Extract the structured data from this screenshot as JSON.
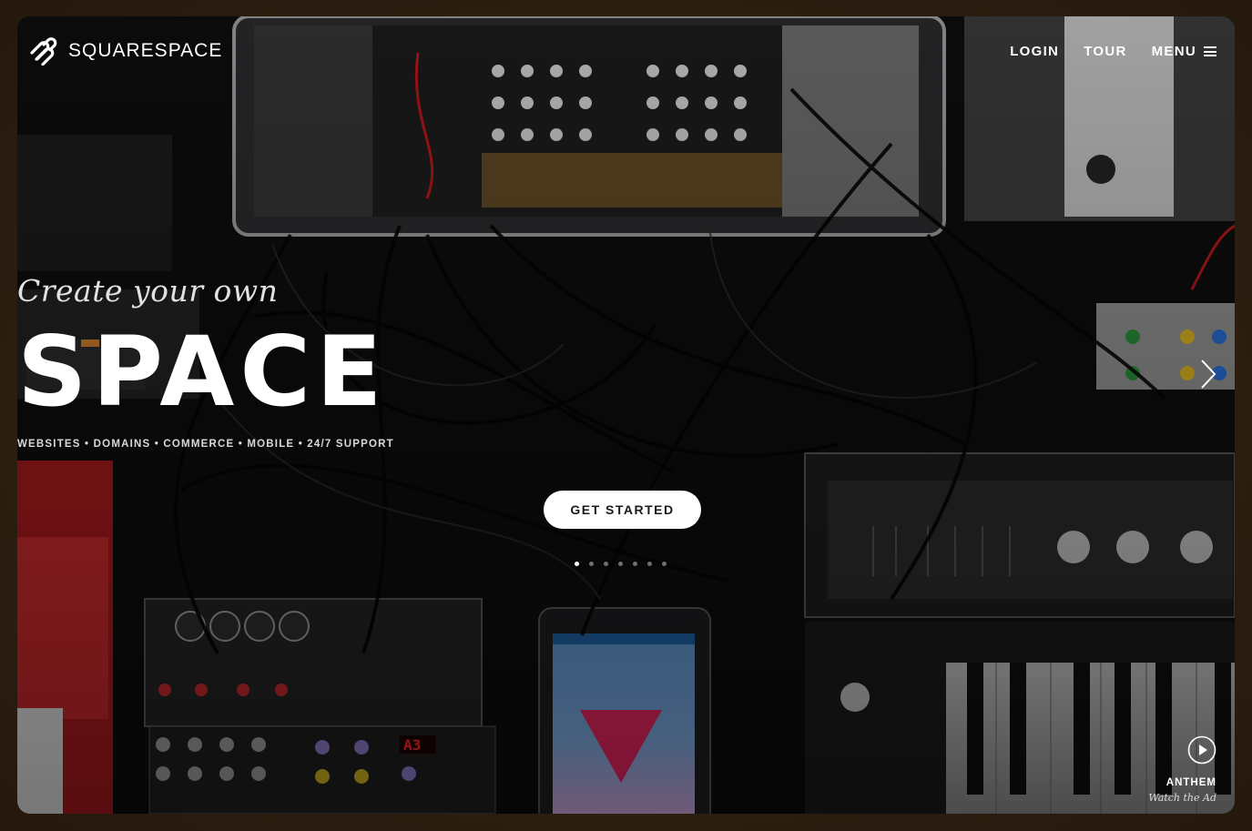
{
  "brand": {
    "name": "SQUARESPACE",
    "icon": "squarespace-logo-icon"
  },
  "nav": {
    "login": "LOGIN",
    "tour": "TOUR",
    "menu": "MENU",
    "menu_icon": "hamburger-icon"
  },
  "hero": {
    "tagline": "Create your own",
    "headline": "SPACE",
    "features": "WEBSITES • DOMAINS • COMMERCE • MOBILE • 24/7 SUPPORT",
    "cta": "GET STARTED",
    "next_icon": "chevron-right-icon"
  },
  "slides": {
    "count": 7,
    "active_index": 0
  },
  "anthem": {
    "title": "ANTHEM",
    "subtitle": "Watch the Ad",
    "icon": "play-icon"
  },
  "colors": {
    "background": "#0b0b0c",
    "frame": "#2a1e12",
    "cta_bg": "#ffffff",
    "tablet_pink": "#e0245e",
    "module_red": "#c0282b"
  }
}
